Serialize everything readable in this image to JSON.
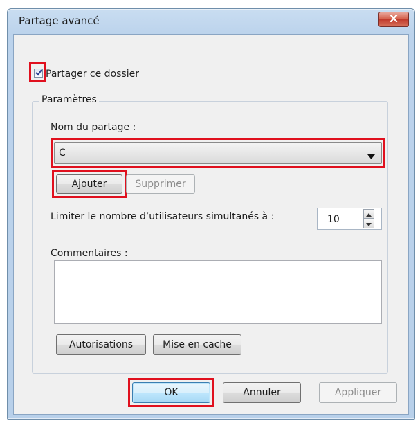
{
  "window": {
    "title": "Partage avancé"
  },
  "share_checkbox": {
    "label": "Partager ce dossier",
    "checked": true
  },
  "settings": {
    "group_title": "Paramètres",
    "share_name_label": "Nom du partage :",
    "share_name_value": "C",
    "add_label": "Ajouter",
    "remove_label": "Supprimer",
    "limit_label": "Limiter le nombre d’utilisateurs simultanés à :",
    "limit_value": "10",
    "comments_label": "Commentaires :",
    "comments_value": "",
    "permissions_label": "Autorisations",
    "caching_label": "Mise en cache"
  },
  "footer": {
    "ok_label": "OK",
    "cancel_label": "Annuler",
    "apply_label": "Appliquer"
  },
  "icons": [
    "close-icon",
    "checkmark-icon",
    "dropdown-arrow-icon",
    "spin-up-icon",
    "spin-down-icon"
  ],
  "colors": {
    "highlight": "#e0101e",
    "close_button": "#c0392b"
  }
}
